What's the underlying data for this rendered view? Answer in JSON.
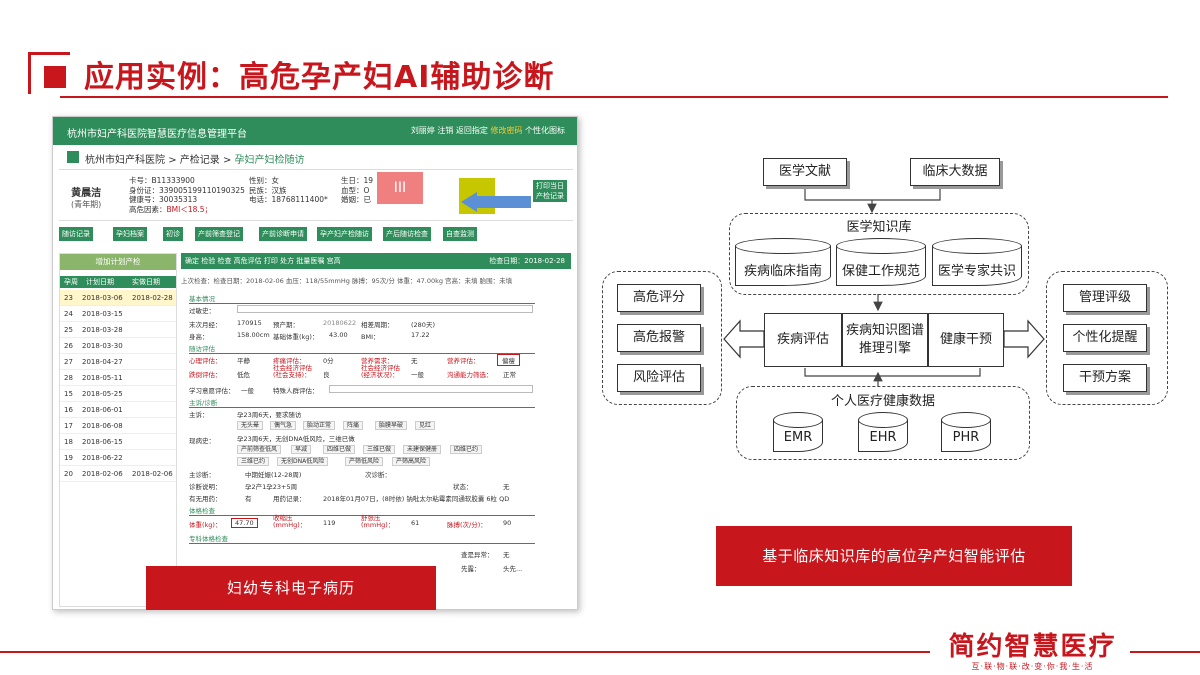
{
  "header": {
    "title": "应用实例：高危孕产妇AI辅助诊断"
  },
  "logo": {
    "main": "简约智慧医疗",
    "sub": "互·联·物·联·改·变·你·我·生·活"
  },
  "screenshot": {
    "system_title": "杭州市妇产科医院智慧医疗信息管理平台",
    "user_bar": {
      "user": "刘丽婷",
      "logout": "注销",
      "back": "返回指定",
      "alert": "修改密码",
      "personal": "个性化图标"
    },
    "breadcrumb": {
      "root": "杭州市妇产科医院",
      "sep1": ">",
      "mid": "产检记录",
      "sep2": ">",
      "current": "孕妇产妇检随访"
    },
    "patient": {
      "name": "黄晨洁",
      "tag": "(青年期)",
      "card_label": "卡号：",
      "card": "B11333900",
      "id_label": "身份证：",
      "id": "339005199110190325",
      "health_label": "健康号：",
      "health": "30035313",
      "risk_label": "高危因素：",
      "risk": "BMI＜18.5；",
      "sex_label": "性别：",
      "sex": "女",
      "ethnic_label": "民族：",
      "ethnic": "汉族",
      "phone_label": "电话：",
      "phone": "18768111400*",
      "birth_label": "生日：",
      "birth": "19",
      "blood_label": "血型：",
      "blood": "O",
      "marital_label": "婚姻：",
      "marital": "已"
    },
    "risk_badge": "III",
    "print_button": "打印当日产检记录",
    "tabs": [
      "随访记录",
      "孕妇档案",
      "初诊",
      "产前筛查登记",
      "产前诊断申请",
      "孕产妇产检随访",
      "产后随访检查",
      "自查监测"
    ],
    "left_panel": {
      "add_button": "增加计划产检",
      "headers": [
        "孕周",
        "计划日期",
        "实做日期"
      ],
      "rows": [
        {
          "week": "23",
          "planned": "2018-03-06",
          "actual": "2018-02-28"
        },
        {
          "week": "24",
          "planned": "2018-03-15",
          "actual": ""
        },
        {
          "week": "25",
          "planned": "2018-03-28",
          "actual": ""
        },
        {
          "week": "26",
          "planned": "2018-03-30",
          "actual": ""
        },
        {
          "week": "27",
          "planned": "2018-04-27",
          "actual": ""
        },
        {
          "week": "28",
          "planned": "2018-05-11",
          "actual": ""
        },
        {
          "week": "15",
          "planned": "2018-05-25",
          "actual": ""
        },
        {
          "week": "16",
          "planned": "2018-06-01",
          "actual": ""
        },
        {
          "week": "17",
          "planned": "2018-06-08",
          "actual": ""
        },
        {
          "week": "18",
          "planned": "2018-06-15",
          "actual": ""
        },
        {
          "week": "19",
          "planned": "2018-06-22",
          "actual": ""
        },
        {
          "week": "20",
          "planned": "2018-02-06",
          "actual": "2018-02-06"
        }
      ]
    },
    "right_panel": {
      "toolbar": "确定  检验  检查  高危评估  打印  处方  批量医嘱  宫高",
      "check_date": "检查日期：2018-02-28",
      "last_visit": "上次检查：检查日期：2018-02-06   血压：118/55mmHg   脉搏：95次/分   体重：47.00kg   宫高：未填   胎围：未填",
      "sections": {
        "basic": "基本情况",
        "assess": "随访评估",
        "complaint": "主诉/诊断",
        "vital": "体格检查",
        "special": "专科体格检查"
      },
      "fields": {
        "allergy": "过敏史：",
        "lmp_label": "末次月经：",
        "lmp": "170915",
        "edc_label": "预产期：",
        "edc": "20180622",
        "ga_label": "相差周期：",
        "ga": "(280天)",
        "height_label": "身高：",
        "height": "158.00cm",
        "weight_base_label": "基础体重(kg)：",
        "weight_base": "43.00",
        "bmi_label": "BMI：",
        "bmi": "17.22",
        "psych_label": "心理评估：",
        "psych": "平静",
        "pain_label": "疼痛评估：",
        "pain": "0分",
        "nutri_label": "营养需求：",
        "nutri": "无",
        "nutri_eval_label": "营养评估：",
        "nutri_eval": "偏瘦",
        "fall_label": "跌倒评估：",
        "fall": "低危",
        "social1": "社会经济评估(社会支持)：",
        "social1_val": "良",
        "social2": "社会经济评估(经济状况)：",
        "social2_val": "一般",
        "comm_label": "沟通能力筛选：",
        "comm": "正常",
        "learn_label": "学习意愿评估：",
        "learn": "一般",
        "special_label": "特殊人群评估：",
        "complaint_label": "主诉：",
        "complaint": "孕23周6天，要求随访",
        "chips1": [
          "无头晕",
          "偶气急",
          "胎动正常",
          "阵痛",
          "胎膜早破",
          "见红"
        ],
        "history_label": "现病史：",
        "history": "孕23周6天，无创DNA低风险，三维已做",
        "chips2": [
          "产前筛查低风",
          "早减",
          "四维已做",
          "三维已做",
          "未建保健册",
          "四维已约"
        ],
        "chips3": [
          "三维已约",
          "无创DNA低风险",
          "产筛低风险",
          "产筛高风险"
        ],
        "dx_label": "主诊断：",
        "dx": "中期妊娠(12-28周)",
        "dx2_label": "次诊断：",
        "dx_note_label": "诊断说明：",
        "dx_note": "孕2产1孕23+5周",
        "status_label": "状态：",
        "status": "无",
        "med_label": "有无用药：",
        "med": "有",
        "med_rec_label": "用药记录：",
        "med_rec": "2018年01月07日，(8时依) 钠吡太尔粘霉素同通软胶囊 6粒 QD",
        "wt_label": "体重(kg)：",
        "wt": "47.70",
        "sbp_label": "收缩压(mmHg)：",
        "sbp": "119",
        "dbp_label": "舒张压(mmHg)：",
        "dbp": "61",
        "pulse_label": "脉搏(次/分)：",
        "pulse": "90",
        "abn_label": "查是异常：",
        "abn": "无",
        "pres_label": "先露：",
        "pres": "头先..."
      }
    },
    "caption": "妇幼专科电子病历"
  },
  "diagram": {
    "literature": "医学文献",
    "bigdata": "临床大数据",
    "kb_title": "医学知识库",
    "kb_items": [
      "疾病临床指南",
      "保健工作规范",
      "医学专家共识"
    ],
    "left_items": [
      "高危评分",
      "高危报警",
      "风险评估"
    ],
    "right_items": [
      "管理评级",
      "个性化提醒",
      "干预方案"
    ],
    "engine": [
      "疾病评估",
      "疾病知识图谱推理引擎",
      "健康干预"
    ],
    "phr_title": "个人医疗健康数据",
    "phr_items": [
      "EMR",
      "EHR",
      "PHR"
    ],
    "caption": "基于临床知识库的高位孕产妇智能评估"
  }
}
